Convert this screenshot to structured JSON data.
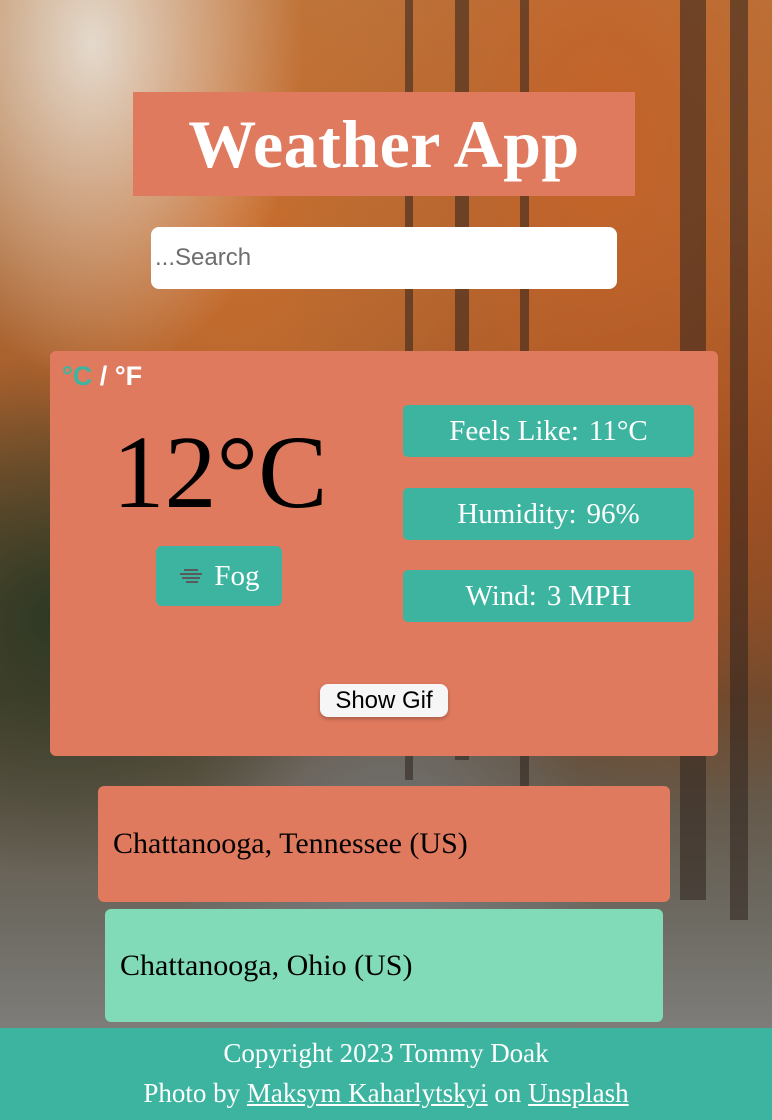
{
  "header": {
    "title": "Weather App"
  },
  "search": {
    "placeholder": "...Search",
    "value": ""
  },
  "weather": {
    "unit_c": "°C",
    "unit_sep": " / ",
    "unit_f": "°F",
    "temperature": "12°C",
    "condition": "Fog",
    "condition_icon": "fog-icon",
    "feels_like_label": "Feels Like:",
    "feels_like_value": "11°C",
    "humidity_label": "Humidity:",
    "humidity_value": "96%",
    "wind_label": "Wind:",
    "wind_value": "3 MPH",
    "gif_button": "Show Gif"
  },
  "results": [
    {
      "label": "Chattanooga, Tennessee (US)"
    },
    {
      "label": "Chattanooga, Ohio (US)"
    }
  ],
  "footer": {
    "copyright": "Copyright 2023 Tommy Doak",
    "photo_prefix": "Photo by",
    "photographer": "Maksym Kaharlytskyi",
    "photo_mid": "on",
    "source": "Unsplash"
  },
  "colors": {
    "accent": "#e07a5f",
    "teal": "#3db4a0",
    "mint": "#81dbb8"
  }
}
